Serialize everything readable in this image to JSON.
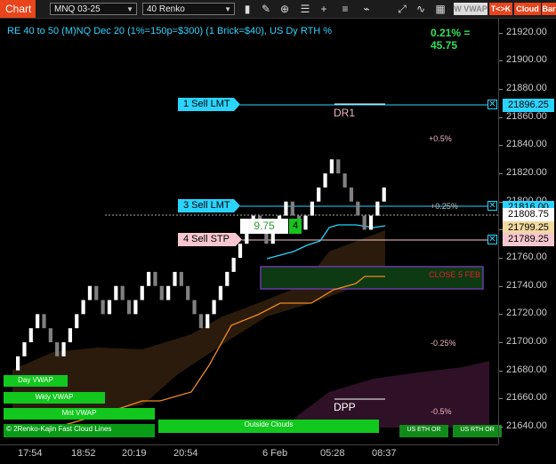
{
  "toolbar": {
    "chart_tab": "Chart",
    "instrument": "MNQ 03-25",
    "bar_type": "40 Renko",
    "icons": [
      "bars-icon",
      "pencil-icon",
      "zoom-icon",
      "properties-icon",
      "plus-icon",
      "list-icon",
      "strategy-icon",
      "chart-trader-icon"
    ],
    "wvwap_label": "W VWAP",
    "tk_label": "T<>K",
    "cloud_label": "Cloud",
    "bar_label": "Bar"
  },
  "chart": {
    "title": "RE 40 to 50 (M)NQ Dec 20 (1%=150p=$300) (1 Brick=$40), US Dy RTH %",
    "pct_readout": "0.21% = 45.75",
    "y_ticks": [
      "21920.00",
      "21900.00",
      "21880.00",
      "21860.00",
      "21840.00",
      "21820.00",
      "21800.00",
      "21780.00",
      "21760.00",
      "21740.00",
      "21720.00",
      "21700.00",
      "21680.00",
      "21660.00",
      "21640.00"
    ],
    "x_ticks": [
      "17:54",
      "18:52",
      "20:19",
      "20:54",
      "6 Feb",
      "05:28",
      "08:37"
    ],
    "orders": {
      "sell_lmt_1": "1 Sell LMT",
      "sell_lmt_3": "3 Sell LMT",
      "sell_stp_4": "4 Sell STP"
    },
    "price_boxes": {
      "p1": "21896.25",
      "p2": "21816.00",
      "p3": "21808.75",
      "p4": "21799.25",
      "p5": "21789.25"
    },
    "pnl_box": {
      "value": "9.75",
      "qty": "4"
    },
    "labels": {
      "dr1": "DR1",
      "dpp": "DPP",
      "plus05": "+0.5%",
      "plus025": "+0.25%",
      "minus025": "-0.25%",
      "minus05": "-0.5%",
      "close_feb": "CLOSE 5 FEB"
    },
    "bottom_labels": {
      "day_vwap": "Day VWAP",
      "wkly_vwap": "Wkly VWAP",
      "mnt_vwap": "Mnt VWAP",
      "renko_lines": "© 2Renko-Kajin Fast Cloud Lines",
      "outside_clouds": "Outside Clouds",
      "us_eth": "US ETH OR",
      "us_rth": "US RTH OR"
    },
    "colors": {
      "accent": "#2ad4ff",
      "up_brick": "#ffffff",
      "down_brick": "#808080",
      "sell_stp": "#f7c7cf",
      "sell_lmt": "#2ad4ff",
      "vwap_green": "#12c81e"
    }
  },
  "chart_data": {
    "type": "renko",
    "brick_size": 10,
    "y_range": [
      21640,
      21930
    ],
    "bricks": [
      {
        "i": 0,
        "o": 21680,
        "c": 21690
      },
      {
        "i": 1,
        "o": 21690,
        "c": 21700
      },
      {
        "i": 2,
        "o": 21700,
        "c": 21710
      },
      {
        "i": 3,
        "o": 21710,
        "c": 21720
      },
      {
        "i": 4,
        "o": 21720,
        "c": 21710
      },
      {
        "i": 5,
        "o": 21710,
        "c": 21700
      },
      {
        "i": 6,
        "o": 21700,
        "c": 21690
      },
      {
        "i": 7,
        "o": 21690,
        "c": 21700
      },
      {
        "i": 8,
        "o": 21700,
        "c": 21710
      },
      {
        "i": 9,
        "o": 21710,
        "c": 21720
      },
      {
        "i": 10,
        "o": 21720,
        "c": 21730
      },
      {
        "i": 11,
        "o": 21730,
        "c": 21740
      },
      {
        "i": 12,
        "o": 21740,
        "c": 21730
      },
      {
        "i": 13,
        "o": 21730,
        "c": 21720
      },
      {
        "i": 14,
        "o": 21720,
        "c": 21730
      },
      {
        "i": 15,
        "o": 21730,
        "c": 21740
      },
      {
        "i": 16,
        "o": 21740,
        "c": 21730
      },
      {
        "i": 17,
        "o": 21730,
        "c": 21720
      },
      {
        "i": 18,
        "o": 21720,
        "c": 21730
      },
      {
        "i": 19,
        "o": 21730,
        "c": 21740
      },
      {
        "i": 20,
        "o": 21740,
        "c": 21750
      },
      {
        "i": 21,
        "o": 21750,
        "c": 21740
      },
      {
        "i": 22,
        "o": 21740,
        "c": 21730
      },
      {
        "i": 23,
        "o": 21730,
        "c": 21740
      },
      {
        "i": 24,
        "o": 21740,
        "c": 21750
      },
      {
        "i": 25,
        "o": 21750,
        "c": 21740
      },
      {
        "i": 26,
        "o": 21740,
        "c": 21730
      },
      {
        "i": 27,
        "o": 21730,
        "c": 21720
      },
      {
        "i": 28,
        "o": 21720,
        "c": 21710
      },
      {
        "i": 29,
        "o": 21710,
        "c": 21720
      },
      {
        "i": 30,
        "o": 21720,
        "c": 21730
      },
      {
        "i": 31,
        "o": 21730,
        "c": 21740
      },
      {
        "i": 32,
        "o": 21740,
        "c": 21750
      },
      {
        "i": 33,
        "o": 21750,
        "c": 21760
      },
      {
        "i": 34,
        "o": 21760,
        "c": 21770
      },
      {
        "i": 35,
        "o": 21770,
        "c": 21780
      },
      {
        "i": 36,
        "o": 21780,
        "c": 21790
      },
      {
        "i": 37,
        "o": 21790,
        "c": 21780
      },
      {
        "i": 38,
        "o": 21780,
        "c": 21770
      },
      {
        "i": 39,
        "o": 21770,
        "c": 21780
      },
      {
        "i": 40,
        "o": 21780,
        "c": 21790
      },
      {
        "i": 41,
        "o": 21790,
        "c": 21800
      },
      {
        "i": 42,
        "o": 21800,
        "c": 21790
      },
      {
        "i": 43,
        "o": 21790,
        "c": 21780
      },
      {
        "i": 44,
        "o": 21780,
        "c": 21790
      },
      {
        "i": 45,
        "o": 21790,
        "c": 21800
      },
      {
        "i": 46,
        "o": 21800,
        "c": 21810
      },
      {
        "i": 47,
        "o": 21810,
        "c": 21820
      },
      {
        "i": 48,
        "o": 21820,
        "c": 21830
      },
      {
        "i": 49,
        "o": 21830,
        "c": 21820
      },
      {
        "i": 50,
        "o": 21820,
        "c": 21810
      },
      {
        "i": 51,
        "o": 21810,
        "c": 21800
      },
      {
        "i": 52,
        "o": 21800,
        "c": 21790
      },
      {
        "i": 53,
        "o": 21790,
        "c": 21780
      },
      {
        "i": 54,
        "o": 21780,
        "c": 21790
      },
      {
        "i": 55,
        "o": 21790,
        "c": 21800
      },
      {
        "i": 56,
        "o": 21800,
        "c": 21810
      }
    ]
  }
}
